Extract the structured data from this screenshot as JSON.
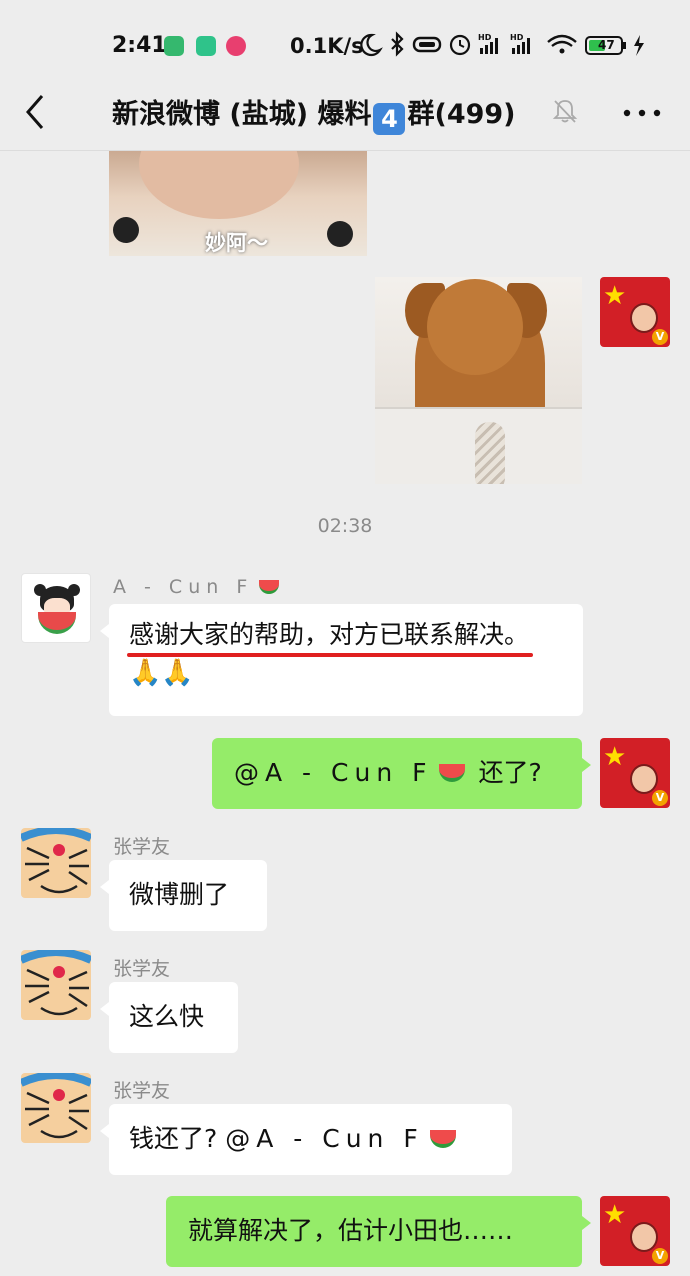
{
  "status_bar": {
    "time": "2:41",
    "network_speed": "0.1K/s",
    "battery": "47",
    "icons": [
      "download-notification-icon",
      "app-notification-icon",
      "app-notification-icon-2",
      "moon-icon",
      "bluetooth-icon",
      "vibrate-icon",
      "alarm-icon",
      "hd-signal-icon",
      "hd-signal-icon-2",
      "wifi-icon",
      "battery-icon",
      "charging-icon"
    ]
  },
  "header": {
    "title_prefix": "新浪微博 (盐城) 爆料",
    "title_badge": "4",
    "title_suffix": "群(499)",
    "icons": [
      "back-icon",
      "mute-icon",
      "more-icon"
    ]
  },
  "chat": {
    "image_top_caption": "妙阿～",
    "timestamp": "02:38",
    "messages": [
      {
        "sender": "A - Cun F",
        "text_line1": "感谢大家的帮助，对方已联系解决。",
        "text_line2": "🙏🙏"
      },
      {
        "self": true,
        "text_mention": "@A - Cun F",
        "text_after": "还了?"
      },
      {
        "sender": "张学友",
        "text": "微博删了"
      },
      {
        "sender": "张学友",
        "text": "这么快"
      },
      {
        "sender": "张学友",
        "text_before": "钱还了? ",
        "text_mention": "@A - Cun F"
      },
      {
        "self": true,
        "text": "就算解决了，估计小田也……"
      }
    ]
  },
  "colors": {
    "background": "#ededed",
    "outgoing_bubble": "#95ec69",
    "incoming_bubble": "#ffffff",
    "underline": "#e02020",
    "avatar_red": "#d21f26"
  }
}
